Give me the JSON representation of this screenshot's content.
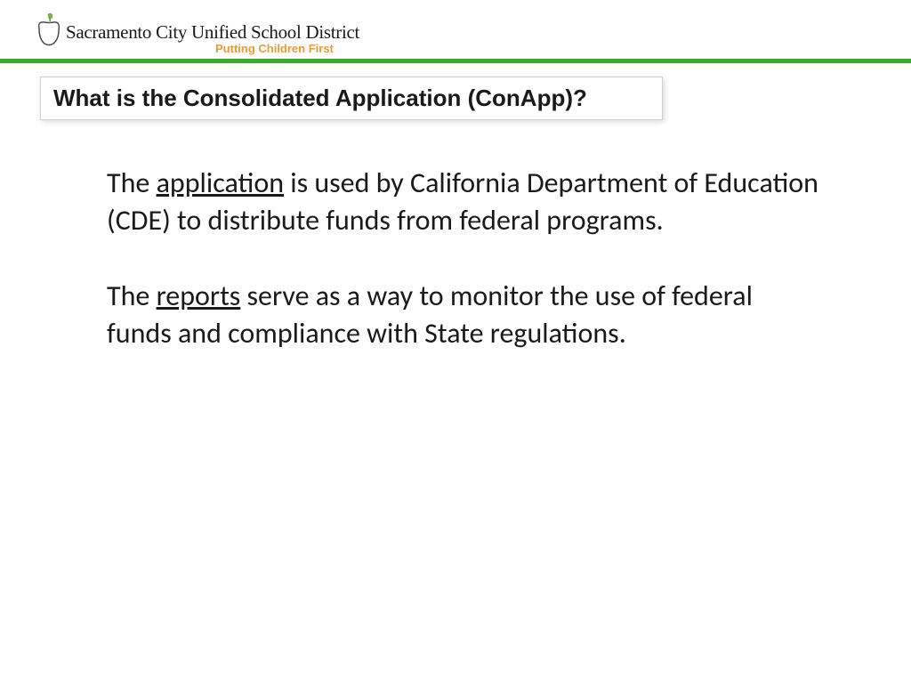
{
  "header": {
    "district_name": "Sacramento City Unified School District",
    "tagline": "Putting Children First"
  },
  "title": "What is the Consolidated Application (ConApp)?",
  "content": {
    "para1": {
      "prefix": "The ",
      "underlined": "application",
      "suffix": " is used by California Department of Education (CDE) to distribute funds from  federal programs."
    },
    "para2": {
      "prefix": "The ",
      "underlined": "reports",
      "suffix": " serve as a way to monitor the use of federal funds and compliance with State regulations."
    }
  },
  "colors": {
    "green": "#3FA535",
    "orange": "#E89B3C"
  }
}
